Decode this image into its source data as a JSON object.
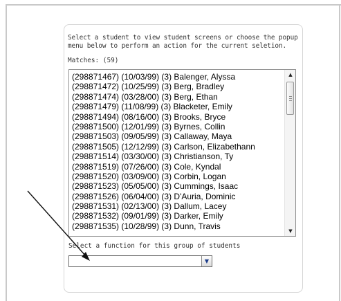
{
  "panel": {
    "instructions": "Select a student to view student screens or choose the popup menu below to perform an action for the current seletion.",
    "matches": "Matches: (59)"
  },
  "students": [
    "(298871467) (10/03/99) (3) Balenger, Alyssa",
    "(298871472) (10/25/99) (3) Berg, Bradley",
    "(298871474) (03/28/00) (3) Berg, Ethan",
    "(298871479) (11/08/99) (3) Blacketer, Emily",
    "(298871494) (08/16/00) (3) Brooks, Bryce",
    "(298871500) (12/01/99) (3) Byrnes, Collin",
    "(298871503) (09/05/99) (3) Callaway, Maya",
    "(298871505) (12/12/99) (3) Carlson, Elizabethann",
    "(298871514) (03/30/00) (3) Christianson, Ty",
    "(298871519) (07/26/00) (3) Cole, Kyndal",
    "(298871520) (03/09/00) (3) Corbin, Logan",
    "(298871523) (05/05/00) (3) Cummings, Isaac",
    "(298871526) (06/04/00) (3) D'Auria, Dominic",
    "(298871531) (02/13/00) (3) Dallum, Lacey",
    "(298871532) (09/01/99) (3) Darker, Emily",
    "(298871535) (10/28/99) (3) Dunn, Travis"
  ],
  "function": {
    "label": "Select a function for this group of students",
    "selected_value": ""
  },
  "icons": {
    "scroll_up": "scroll-up-arrow-icon",
    "scroll_down": "scroll-down-arrow-icon",
    "dropdown": "chevron-down-icon",
    "annotation": "annotation-arrow-icon"
  }
}
